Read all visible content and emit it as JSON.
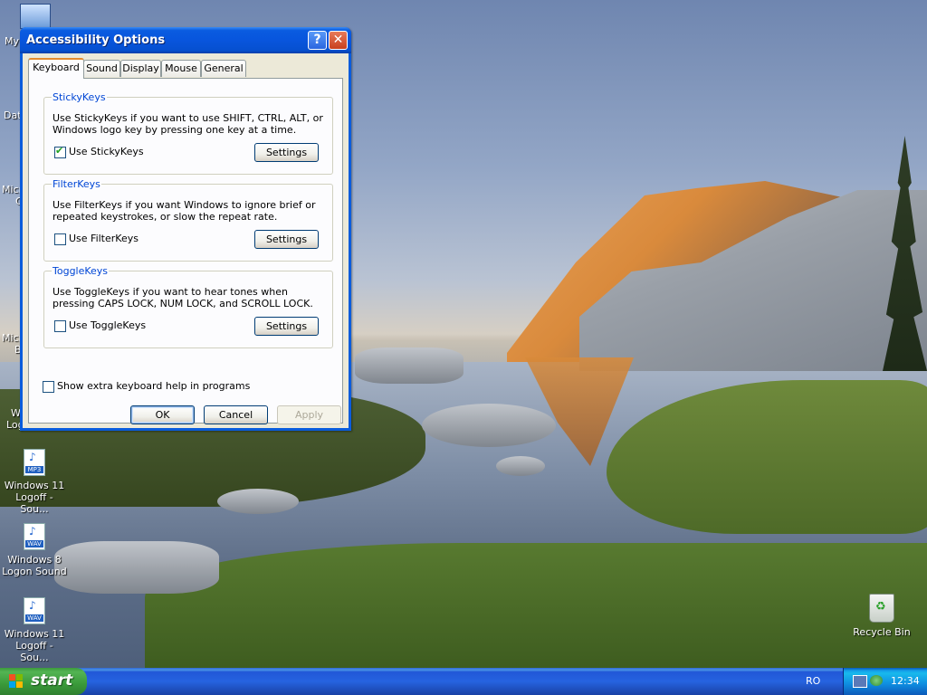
{
  "dialog": {
    "title": "Accessibility Options",
    "help_button": "?",
    "close_button": "✕",
    "tabs": [
      "Keyboard",
      "Sound",
      "Display",
      "Mouse",
      "General"
    ],
    "active_tab": "Keyboard",
    "sticky": {
      "title": "StickyKeys",
      "description": "Use StickyKeys if you want to use SHIFT, CTRL, ALT, or Windows logo key by pressing one key at a time.",
      "checkbox_label": "Use StickyKeys",
      "checked": true,
      "settings_label": "Settings"
    },
    "filter": {
      "title": "FilterKeys",
      "description": "Use FilterKeys if you want Windows to ignore brief or repeated keystrokes, or slow the repeat rate.",
      "checkbox_label": "Use FilterKeys",
      "checked": false,
      "settings_label": "Settings"
    },
    "toggle": {
      "title": "ToggleKeys",
      "description": "Use ToggleKeys if you want to hear tones when pressing CAPS LOCK, NUM LOCK, and SCROLL LOCK.",
      "checkbox_label": "Use ToggleKeys",
      "checked": false,
      "settings_label": "Settings"
    },
    "extra_help_label": "Show extra keyboard help in programs",
    "ok_label": "OK",
    "cancel_label": "Cancel",
    "apply_label": "Apply"
  },
  "desktop": {
    "icons": [
      {
        "label": "Windows 11 Logoff - Sou...",
        "badge": "MP3"
      },
      {
        "label": "Windows 8 Logon Sound",
        "badge": "WAV"
      },
      {
        "label": "Windows 11 Logoff - Sou...",
        "badge": "WAV"
      }
    ],
    "recycle_bin": "Recycle Bin",
    "partial_labels": [
      "My",
      "Dat",
      "Micro",
      "C",
      "Micro",
      "B",
      "W",
      "Log"
    ]
  },
  "taskbar": {
    "start_label": "start",
    "language": "RO",
    "clock": "12:34"
  },
  "colors": {
    "title_bar": "#0855dd",
    "group_title": "#0046d5",
    "start_green": "#3a9a3a",
    "tray_blue": "#0f8de0"
  }
}
